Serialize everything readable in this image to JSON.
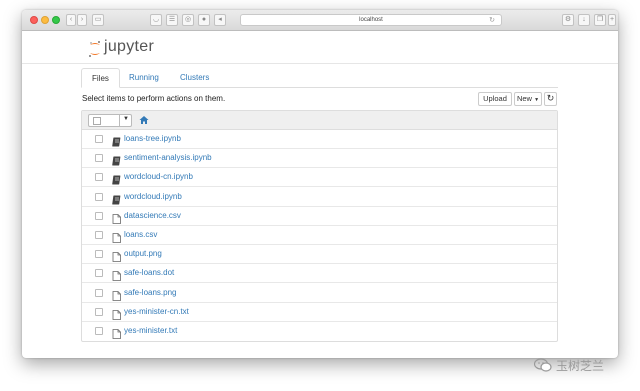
{
  "browser": {
    "url": "localhost",
    "colors": {
      "close": "#fc605c",
      "minimize": "#fdbc40",
      "zoom": "#34c84a"
    }
  },
  "app": {
    "brand": "jupyter",
    "logo_color": "#f37726"
  },
  "tabs": [
    {
      "label": "Files",
      "active": true
    },
    {
      "label": "Running",
      "active": false
    },
    {
      "label": "Clusters",
      "active": false
    }
  ],
  "toolbar": {
    "instruction": "Select items to perform actions on them.",
    "upload_label": "Upload",
    "new_label": "New",
    "refresh_icon": "refresh-icon"
  },
  "files": [
    {
      "name": "loans-tree.ipynb",
      "type": "notebook"
    },
    {
      "name": "sentiment-analysis.ipynb",
      "type": "notebook"
    },
    {
      "name": "wordcloud-cn.ipynb",
      "type": "notebook"
    },
    {
      "name": "wordcloud.ipynb",
      "type": "notebook"
    },
    {
      "name": "datascience.csv",
      "type": "file"
    },
    {
      "name": "loans.csv",
      "type": "file"
    },
    {
      "name": "output.png",
      "type": "file"
    },
    {
      "name": "safe-loans.dot",
      "type": "file"
    },
    {
      "name": "safe-loans.png",
      "type": "file"
    },
    {
      "name": "yes-minister-cn.txt",
      "type": "file"
    },
    {
      "name": "yes-minister.txt",
      "type": "file"
    }
  ],
  "watermark": {
    "text": "玉树芝兰"
  }
}
